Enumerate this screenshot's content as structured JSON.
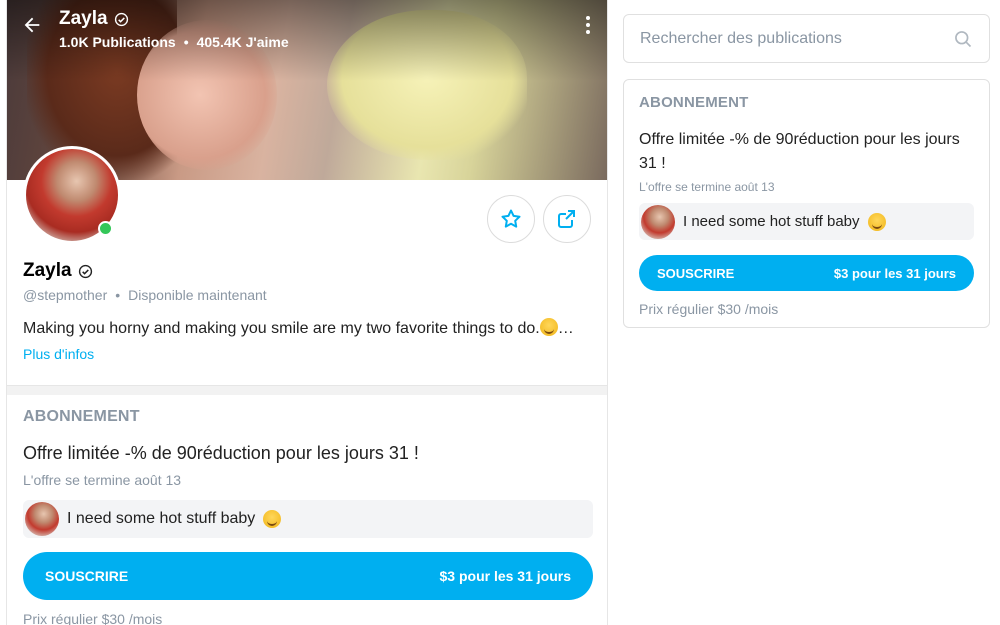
{
  "header": {
    "name": "Zayla",
    "publications": "1.0K Publications",
    "likes": "405.4K J'aime"
  },
  "profile": {
    "name": "Zayla",
    "handle": "@stepmother",
    "status": "Disponible maintenant",
    "bio": "Making you horny and making you smile are my two favorite things to do.",
    "bio_ellipsis": "…",
    "more_info": "Plus d'infos"
  },
  "subscription": {
    "header": "ABONNEMENT",
    "offer_title": "Offre limitée -% de 90réduction pour les jours 31 !",
    "offer_ends": "L'offre se termine août 13",
    "message": "I need some hot stuff baby",
    "button_label": "SOUSCRIRE",
    "button_price": "$3 pour les 31 jours",
    "regular_price": "Prix régulier $30 /mois"
  },
  "sidebar": {
    "search_placeholder": "Rechercher des publications"
  },
  "colors": {
    "accent": "#00aff0",
    "muted": "#8a96a3",
    "online": "#34c759"
  },
  "icons": [
    "back-arrow-icon",
    "verified-icon",
    "more-vertical-icon",
    "star-icon",
    "share-icon",
    "search-icon",
    "wink-emoji-icon"
  ]
}
